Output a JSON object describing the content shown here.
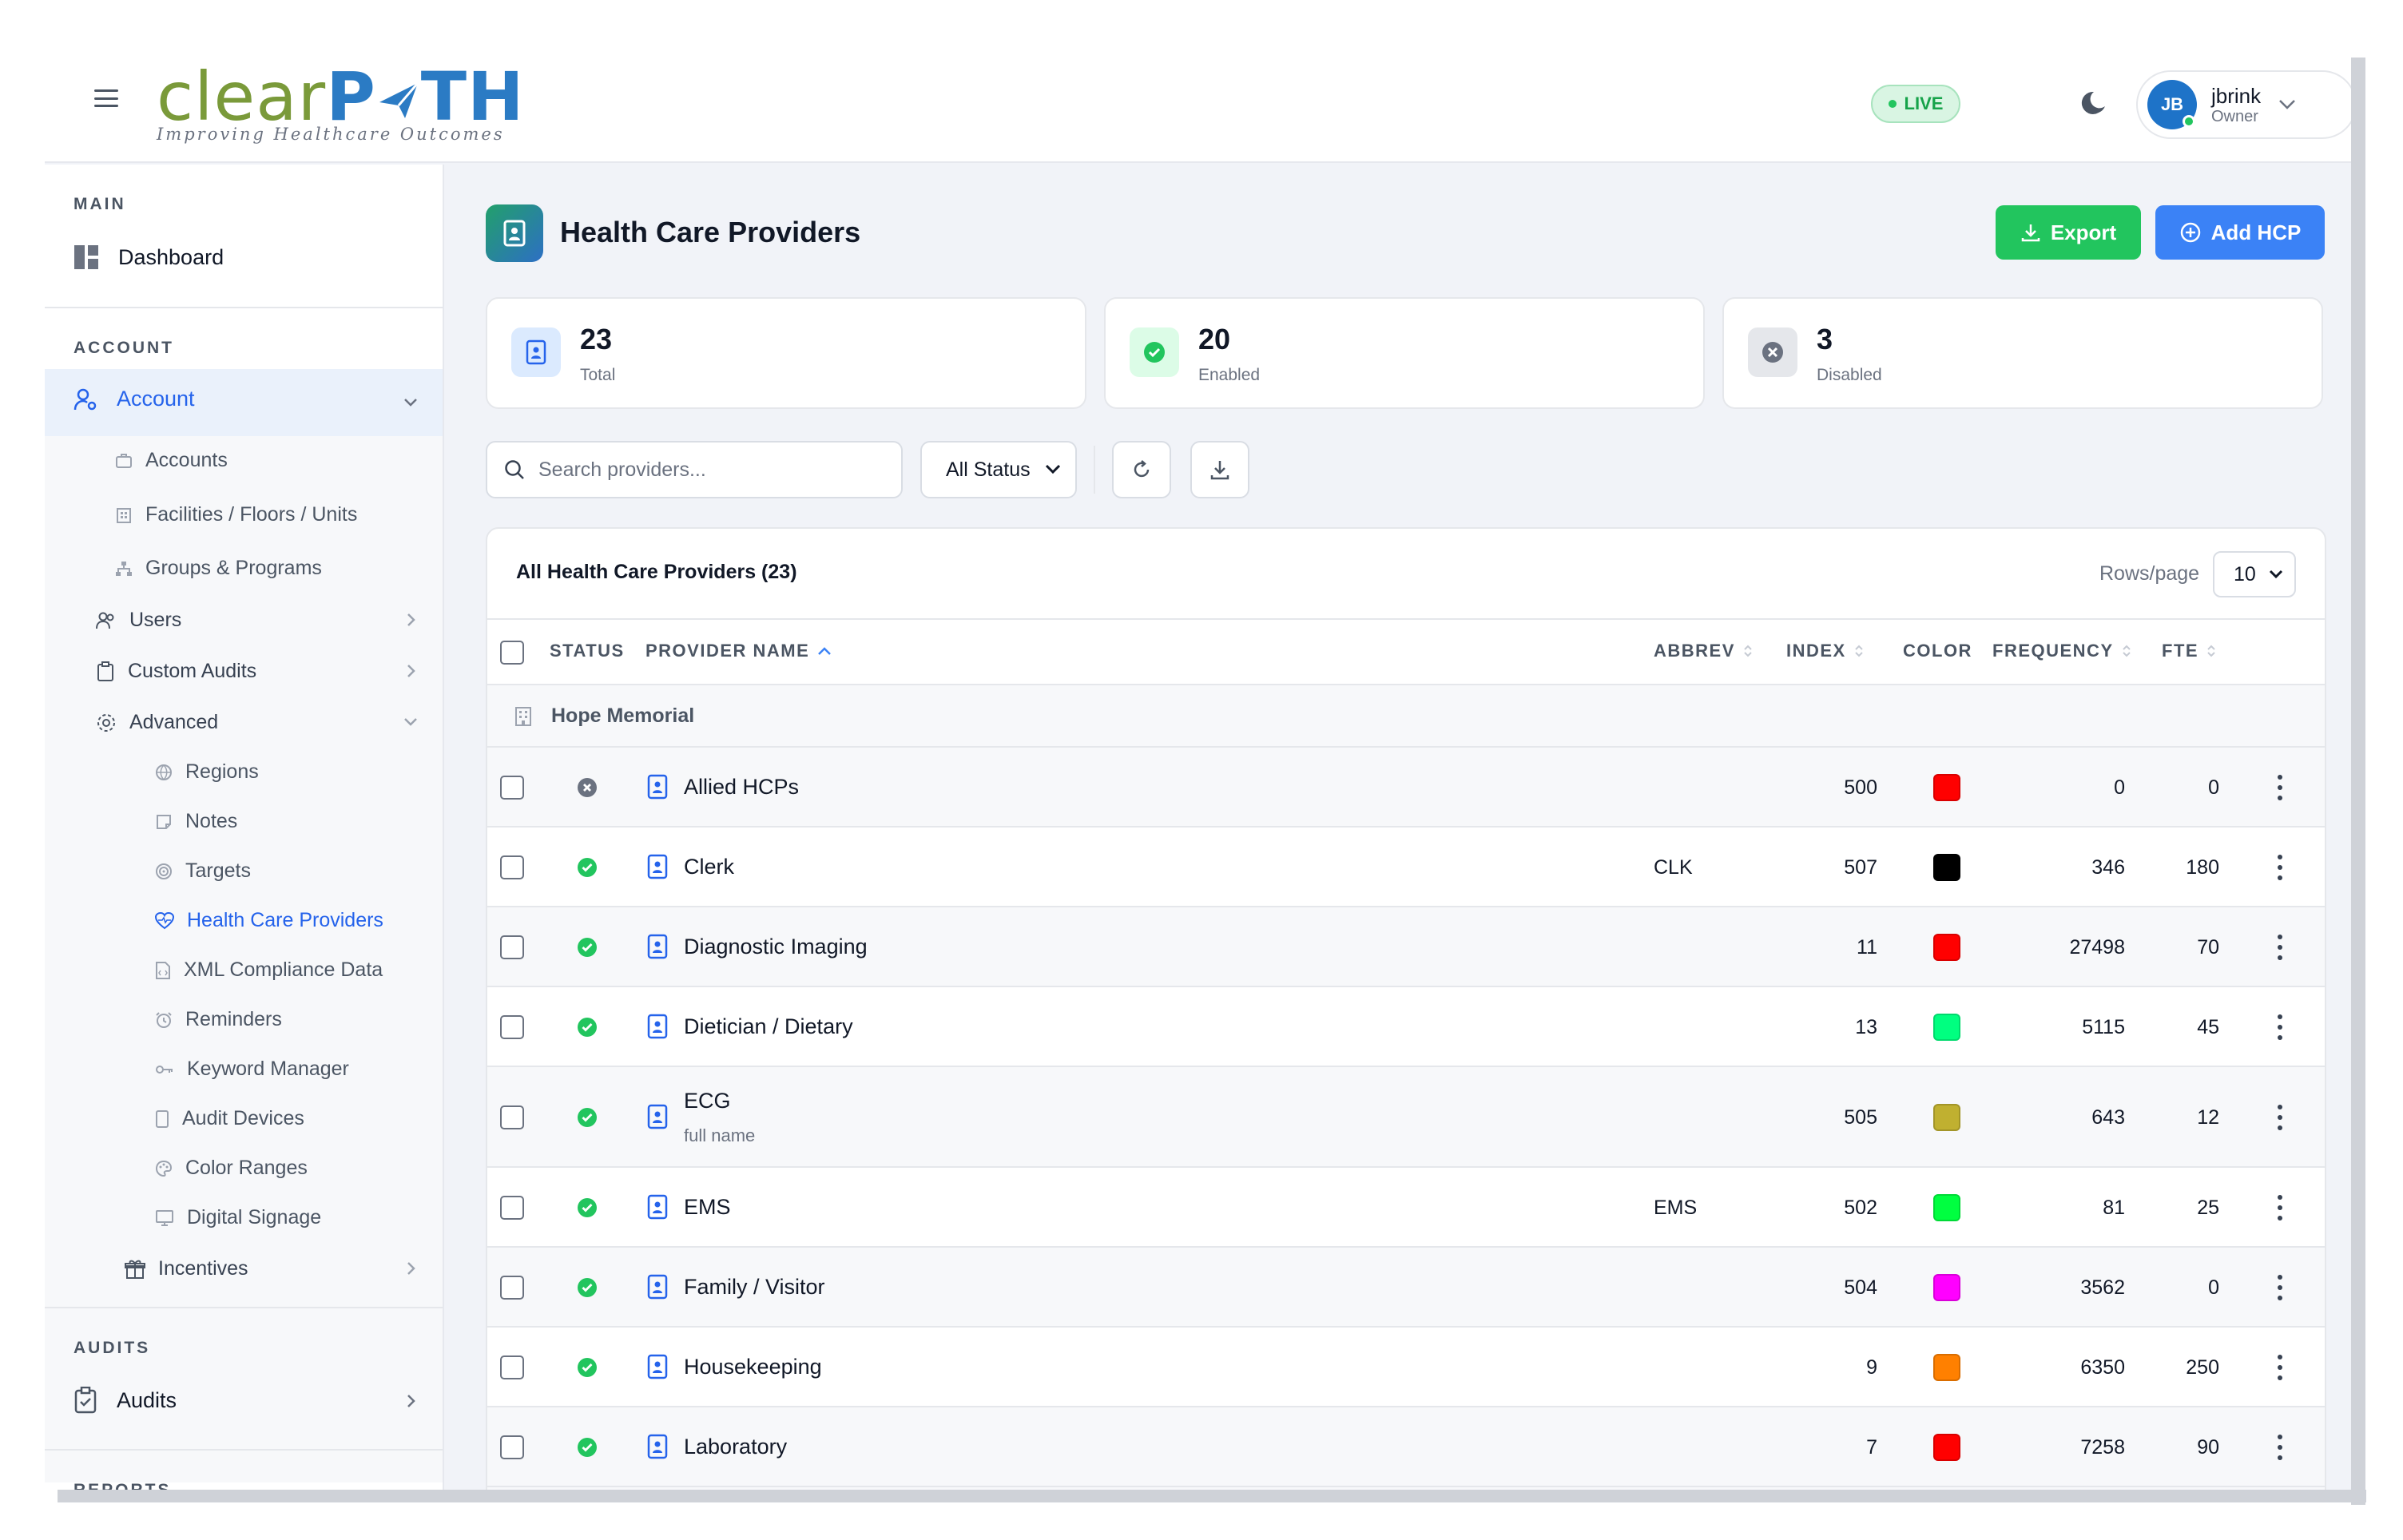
{
  "header": {
    "logo_clear": "clear",
    "logo_path": "P",
    "logo_path_end": "TH",
    "logo_tagline": "Improving Healthcare Outcomes",
    "live_label": "LIVE",
    "user_initials": "JB",
    "user_name": "jbrink",
    "user_role": "Owner"
  },
  "sidebar": {
    "main_label": "MAIN",
    "dashboard": "Dashboard",
    "account_label": "ACCOUNT",
    "account": "Account",
    "account_items": [
      "Accounts",
      "Facilities / Floors / Units",
      "Groups & Programs"
    ],
    "users": "Users",
    "custom_audits": "Custom Audits",
    "advanced": "Advanced",
    "advanced_items": [
      "Regions",
      "Notes",
      "Targets",
      "Health Care Providers",
      "XML Compliance Data",
      "Reminders",
      "Keyword Manager",
      "Audit Devices",
      "Color Ranges",
      "Digital Signage"
    ],
    "incentives": "Incentives",
    "audits_label": "AUDITS",
    "audits": "Audits",
    "reports_label": "REPORTS"
  },
  "page": {
    "title": "Health Care Providers",
    "export_label": "Export",
    "add_label": "Add HCP"
  },
  "stats": [
    {
      "value": "23",
      "label": "Total"
    },
    {
      "value": "20",
      "label": "Enabled"
    },
    {
      "value": "3",
      "label": "Disabled"
    }
  ],
  "toolbar": {
    "search_placeholder": "Search providers...",
    "status_filter": "All Status"
  },
  "table": {
    "title": "All Health Care Providers (23)",
    "rows_per_page_label": "Rows/page",
    "rows_per_page": "10",
    "columns": {
      "status": "STATUS",
      "name": "PROVIDER NAME",
      "abbrev": "ABBREV",
      "index": "INDEX",
      "color": "COLOR",
      "frequency": "FREQUENCY",
      "fte": "FTE"
    },
    "group": "Hope Memorial",
    "rows": [
      {
        "status": "disabled",
        "name": "Allied HCPs",
        "sub": "",
        "abbrev": "",
        "index": "500",
        "color": "#ff0000",
        "frequency": "0",
        "fte": "0"
      },
      {
        "status": "enabled",
        "name": "Clerk",
        "sub": "",
        "abbrev": "CLK",
        "index": "507",
        "color": "#000000",
        "frequency": "346",
        "fte": "180"
      },
      {
        "status": "enabled",
        "name": "Diagnostic Imaging",
        "sub": "",
        "abbrev": "",
        "index": "11",
        "color": "#ff0000",
        "frequency": "27498",
        "fte": "70"
      },
      {
        "status": "enabled",
        "name": "Dietician / Dietary",
        "sub": "",
        "abbrev": "",
        "index": "13",
        "color": "#00ff80",
        "frequency": "5115",
        "fte": "45"
      },
      {
        "status": "enabled",
        "name": "ECG",
        "sub": "full name",
        "abbrev": "",
        "index": "505",
        "color": "#c0b030",
        "frequency": "643",
        "fte": "12"
      },
      {
        "status": "enabled",
        "name": "EMS",
        "sub": "",
        "abbrev": "EMS",
        "index": "502",
        "color": "#00ff40",
        "frequency": "81",
        "fte": "25"
      },
      {
        "status": "enabled",
        "name": "Family / Visitor",
        "sub": "",
        "abbrev": "",
        "index": "504",
        "color": "#ff00ff",
        "frequency": "3562",
        "fte": "0"
      },
      {
        "status": "enabled",
        "name": "Housekeeping",
        "sub": "",
        "abbrev": "",
        "index": "9",
        "color": "#ff8000",
        "frequency": "6350",
        "fte": "250"
      },
      {
        "status": "enabled",
        "name": "Laboratory",
        "sub": "",
        "abbrev": "",
        "index": "7",
        "color": "#ff0000",
        "frequency": "7258",
        "fte": "90"
      }
    ],
    "partial_row_color": "#ff0000"
  }
}
